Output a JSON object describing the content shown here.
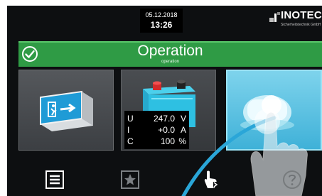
{
  "header": {
    "date": "05.12.2018",
    "time": "13:26"
  },
  "brand": {
    "name": "INOTEC",
    "subtitle": "Sicherheitstechnik GmbH"
  },
  "status": {
    "title": "Operation",
    "subtitle": "operation",
    "color": "#2f9b45"
  },
  "tiles": [
    {
      "name": "exit-sign",
      "icon": "exit-sign-icon"
    },
    {
      "name": "battery",
      "icon": "battery-icon"
    },
    {
      "name": "device",
      "icon": "device-icon",
      "selected": true
    }
  ],
  "readings": [
    {
      "symbol": "U",
      "value": "247.0",
      "unit": "V"
    },
    {
      "symbol": "I",
      "value": "+0.0",
      "unit": "A"
    },
    {
      "symbol": "C",
      "value": "100",
      "unit": "%"
    }
  ],
  "nav": [
    "list-icon",
    "star-icon",
    "pointer-icon",
    "help-icon"
  ],
  "colors": {
    "accent": "#5ac8ea",
    "ok": "#2f9b45",
    "background": "#0d0f11"
  }
}
